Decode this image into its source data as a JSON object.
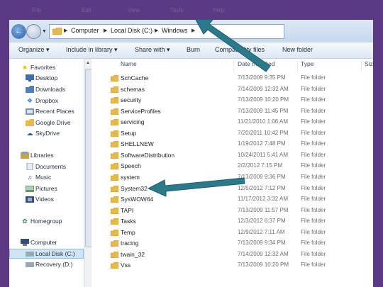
{
  "top_ghost": {
    "items": [
      "File",
      "Edit",
      "View",
      "Tools",
      "Help"
    ]
  },
  "address": {
    "crumbs": [
      "Computer",
      "Local Disk (C:)",
      "Windows"
    ]
  },
  "toolbar": {
    "organize": "Organize ▾",
    "include_library": "Include in library ▾",
    "share_with": "Share with ▾",
    "burn": "Burn",
    "compatibility": "Compatibility files",
    "new_folder": "New folder"
  },
  "nav": {
    "favorites": "Favorites",
    "desktop": "Desktop",
    "downloads": "Downloads",
    "dropbox": "Dropbox",
    "recent_places": "Recent Places",
    "google_drive": "Google Drive",
    "skydrive": "SkyDrive",
    "libraries": "Libraries",
    "documents": "Documents",
    "music": "Music",
    "pictures": "Pictures",
    "videos": "Videos",
    "homegroup": "Homegroup",
    "computer": "Computer",
    "local_disk": "Local Disk (C:)",
    "recovery": "Recovery (D:)"
  },
  "columns": {
    "name": "Name",
    "date": "Date modified",
    "type": "Type",
    "size": "Size"
  },
  "files": [
    {
      "name": "SchCache",
      "date": "7/13/2009 9:35 PM",
      "type": "File folder"
    },
    {
      "name": "schemas",
      "date": "7/14/2009 12:32 AM",
      "type": "File folder"
    },
    {
      "name": "security",
      "date": "7/13/2009 10:20 PM",
      "type": "File folder"
    },
    {
      "name": "ServiceProfiles",
      "date": "7/13/2009 11:45 PM",
      "type": "File folder"
    },
    {
      "name": "servicing",
      "date": "11/21/2010 1:06 AM",
      "type": "File folder"
    },
    {
      "name": "Setup",
      "date": "7/20/2011 10:42 PM",
      "type": "File folder"
    },
    {
      "name": "SHELLNEW",
      "date": "1/19/2012 7:48 PM",
      "type": "File folder"
    },
    {
      "name": "SoftwareDistribution",
      "date": "10/24/2011 5:41 AM",
      "type": "File folder"
    },
    {
      "name": "Speech",
      "date": "2/2/2012 7:15 PM",
      "type": "File folder"
    },
    {
      "name": "system",
      "date": "7/13/2009 9:36 PM",
      "type": "File folder"
    },
    {
      "name": "System32",
      "date": "12/5/2012 7:12 PM",
      "type": "File folder"
    },
    {
      "name": "SysWOW64",
      "date": "11/17/2012 3:32 AM",
      "type": "File folder"
    },
    {
      "name": "TAPI",
      "date": "7/13/2009 11:57 PM",
      "type": "File folder"
    },
    {
      "name": "Tasks",
      "date": "12/3/2012 6:37 PM",
      "type": "File folder"
    },
    {
      "name": "Temp",
      "date": "12/9/2012 7:11 AM",
      "type": "File folder"
    },
    {
      "name": "tracing",
      "date": "7/13/2009 9:34 PM",
      "type": "File folder"
    },
    {
      "name": "twain_32",
      "date": "7/14/2009 12:32 AM",
      "type": "File folder"
    },
    {
      "name": "Vss",
      "date": "7/13/2009 10:20 PM",
      "type": "File folder"
    }
  ],
  "colors": {
    "slide_bg": "#5b3a83",
    "arrow": "#2a7a8c",
    "folder": "#e8b84a"
  }
}
